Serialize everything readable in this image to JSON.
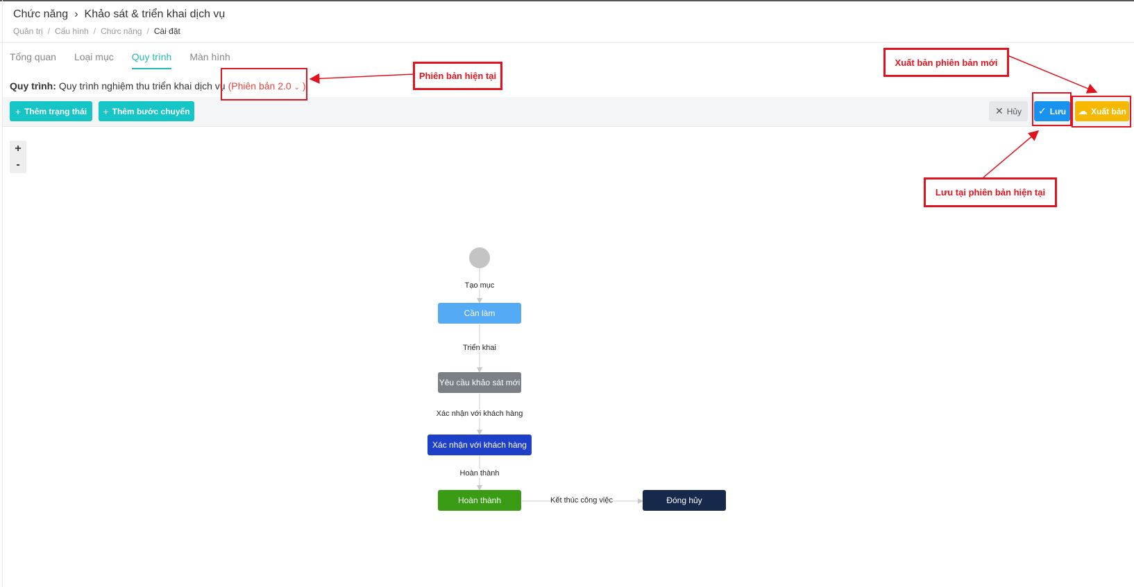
{
  "header": {
    "title_root": "Chức năng",
    "title_page": "Khảo sát & triển khai dịch vụ",
    "breadcrumb": [
      "Quản trị",
      "Cấu hình",
      "Chức năng"
    ],
    "breadcrumb_current": "Cài đặt"
  },
  "tabs": [
    {
      "label": "Tổng quan"
    },
    {
      "label": "Loại mục"
    },
    {
      "label": "Quy trình",
      "active": true
    },
    {
      "label": "Màn hình"
    }
  ],
  "process": {
    "label": "Quy trình:",
    "name": "Quy trình nghiệm thu triển khai dịch vụ",
    "version_open": "(",
    "version": "Phiên bản 2.0",
    "version_close": ")"
  },
  "toolbar": {
    "add_state": "Thêm trạng thái",
    "add_transition": "Thêm bước chuyển",
    "cancel": "Hủy",
    "save": "Lưu",
    "publish": "Xuất bản"
  },
  "zoom": {
    "in": "+",
    "out": "-"
  },
  "workflow": {
    "nodes": [
      {
        "id": "can-lam",
        "label": "Cần làm",
        "color": "#55aaf5"
      },
      {
        "id": "yeu-cau",
        "label": "Yêu cầu khảo sát mới",
        "color": "#7b7f86"
      },
      {
        "id": "xac-nhan",
        "label": "Xác nhận với khách hàng",
        "color": "#1e40c8"
      },
      {
        "id": "hoan-thanh",
        "label": "Hoàn thành",
        "color": "#3a9b14"
      },
      {
        "id": "dong-huy",
        "label": "Đóng hủy",
        "color": "#17294a"
      }
    ],
    "edges": [
      {
        "label": "Tạo mục"
      },
      {
        "label": "Triển khai"
      },
      {
        "label": "Xác nhận với khách hàng"
      },
      {
        "label": "Hoàn thành"
      },
      {
        "label": "Kết thúc công việc"
      }
    ]
  },
  "annotations": {
    "current_version": "Phiên bản hiện tại",
    "publish_new": "Xuất bản phiên bản mới",
    "save_current": "Lưu tại phiên bản hiện tại"
  },
  "colors": {
    "teal": "#16c5c5",
    "save_blue": "#1793ef",
    "publish_yellow": "#f6b800",
    "annotation_red": "#e0141e",
    "version_red": "#e0453b"
  }
}
